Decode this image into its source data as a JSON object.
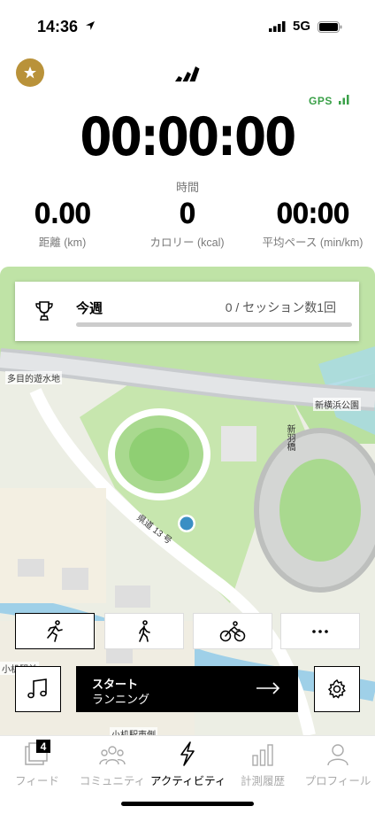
{
  "status_bar": {
    "time": "14:36",
    "network": "5G"
  },
  "header": {
    "gps_label": "GPS"
  },
  "timer": {
    "value": "00:00:00",
    "label": "時間"
  },
  "stats": [
    {
      "value": "0.00",
      "label": "距離 (km)"
    },
    {
      "value": "0",
      "label": "カロリー (kcal)"
    },
    {
      "value": "00:00",
      "label": "平均ペース (min/km)"
    }
  ],
  "goal": {
    "title": "今週",
    "sessions": "0 / セッション数1回",
    "progress": 0
  },
  "map_labels": {
    "reservoir": "多目的遊水地",
    "park": "新横浜公園",
    "route": "県道 13 号",
    "bridge": "新羽橋",
    "station_east": "小机駅東側",
    "station": "小机駅前"
  },
  "activities": [
    {
      "name": "running",
      "icon": "running-icon",
      "selected": true
    },
    {
      "name": "walking",
      "icon": "walking-icon",
      "selected": false
    },
    {
      "name": "cycling",
      "icon": "cycling-icon",
      "selected": false
    },
    {
      "name": "more",
      "icon": "more-icon",
      "selected": false
    }
  ],
  "start": {
    "line1": "スタート",
    "line2": "ランニング"
  },
  "tabs": [
    {
      "label": "フィード",
      "badge": "4"
    },
    {
      "label": "コミュニティ"
    },
    {
      "label": "アクティビティ"
    },
    {
      "label": "計測履歴"
    },
    {
      "label": "プロフィール"
    }
  ],
  "colors": {
    "accent_gold": "#b9923a",
    "gps_green": "#3aa048",
    "location_blue": "#3a8fc4"
  }
}
